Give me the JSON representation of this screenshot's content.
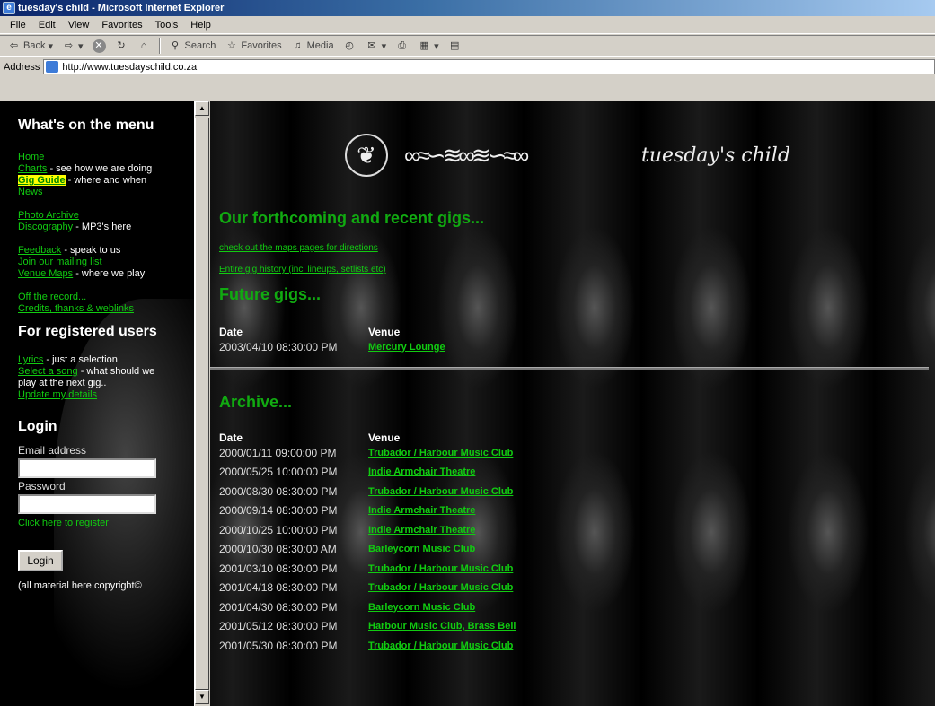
{
  "window": {
    "title": "tuesday's child - Microsoft Internet Explorer"
  },
  "menubar": [
    "File",
    "Edit",
    "View",
    "Favorites",
    "Tools",
    "Help"
  ],
  "toolbar": {
    "back": "Back",
    "search": "Search",
    "favorites": "Favorites",
    "media": "Media"
  },
  "address": {
    "label": "Address",
    "url": "http://www.tuesdayschild.co.za"
  },
  "sidebar": {
    "menu_heading": "What's on the menu",
    "home": "Home",
    "charts": "Charts",
    "charts_desc": " - see how we are doing",
    "gig_guide": "Gig Guide",
    "gig_guide_desc": " - where and when",
    "news": "News",
    "photo_archive": "Photo Archive",
    "discography": "Discography",
    "discography_desc": " - MP3's here",
    "feedback": "Feedback",
    "feedback_desc": " - speak to us",
    "mailing_list": "Join our mailing list",
    "venue_maps": "Venue Maps",
    "venue_maps_desc": " - where we play",
    "off_record": "Off the record...",
    "credits": "Credits, thanks & weblinks",
    "registered_heading": "For registered users",
    "lyrics": "Lyrics",
    "lyrics_desc": " - just a selection",
    "select_song": "Select a song",
    "select_song_desc": " - what should we play at the next gig..",
    "update_details": "Update my details",
    "login_heading": "Login",
    "email_label": "Email address",
    "password_label": "Password",
    "register_link": "Click here to register",
    "login_button": "Login",
    "copyright": "(all material here copyright©"
  },
  "main": {
    "heading": "Our forthcoming and recent gigs...",
    "maps_link": "check out the maps pages for directions",
    "history_link": "Entire gig history (incl lineups, setlists etc)",
    "future_heading": "Future gigs...",
    "archive_heading": "Archive...",
    "col_date": "Date",
    "col_venue": "Venue",
    "future_gigs": [
      {
        "date": "2003/04/10 08:30:00 PM",
        "venue": "Mercury Lounge"
      }
    ],
    "archive_gigs": [
      {
        "date": "2000/01/11 09:00:00 PM",
        "venue": "Trubador / Harbour Music Club"
      },
      {
        "date": "2000/05/25 10:00:00 PM",
        "venue": "Indie Armchair Theatre"
      },
      {
        "date": "2000/08/30 08:30:00 PM",
        "venue": "Trubador / Harbour Music Club"
      },
      {
        "date": "2000/09/14 08:30:00 PM",
        "venue": "Indie Armchair Theatre"
      },
      {
        "date": "2000/10/25 10:00:00 PM",
        "venue": "Indie Armchair Theatre"
      },
      {
        "date": "2000/10/30 08:30:00 AM",
        "venue": "Barleycorn Music Club"
      },
      {
        "date": "2001/03/10 08:30:00 PM",
        "venue": "Trubador / Harbour Music Club"
      },
      {
        "date": "2001/04/18 08:30:00 PM",
        "venue": "Trubador / Harbour Music Club"
      },
      {
        "date": "2001/04/30 08:30:00 PM",
        "venue": "Barleycorn Music Club"
      },
      {
        "date": "2001/05/12 08:30:00 PM",
        "venue": "Harbour Music Club, Brass Bell"
      },
      {
        "date": "2001/05/30 08:30:00 PM",
        "venue": "Trubador / Harbour Music Club"
      }
    ],
    "logo_text": "tuesday's child"
  }
}
